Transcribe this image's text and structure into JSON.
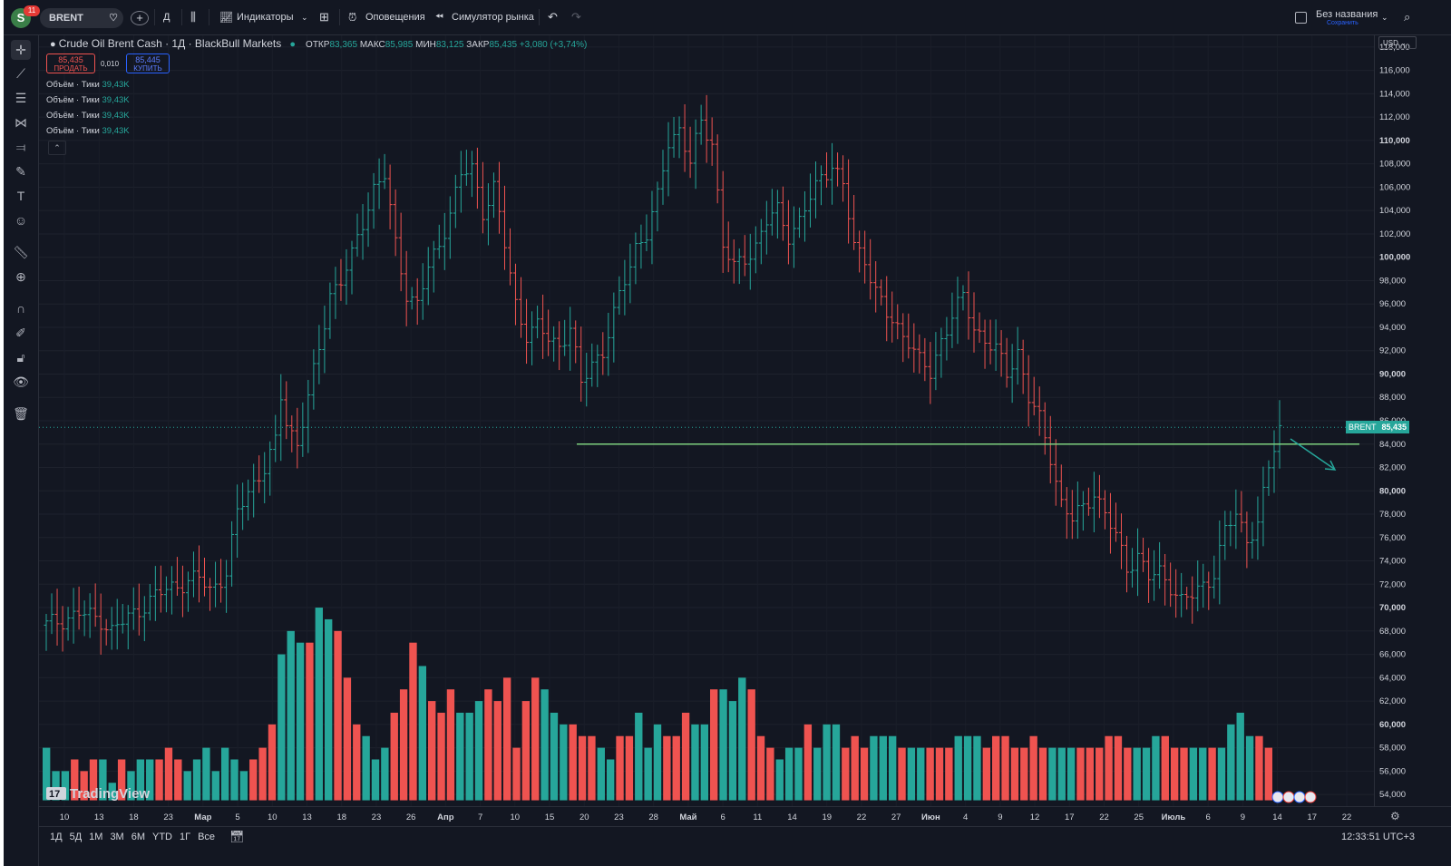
{
  "topbar": {
    "avatar_letter": "S",
    "avatar_badge": "11",
    "symbol": "BRENT",
    "interval": "Д",
    "indicators_label": "Индикаторы",
    "alerts_label": "Оповещения",
    "replay_label": "Симулятор рынка",
    "layout_name": "Без названия",
    "layout_save": "Сохранить"
  },
  "legend": {
    "title": "Crude Oil Brent Cash · 1Д · BlackBull Markets",
    "ohlc": [
      {
        "label": "ОТКР",
        "value": "83,365"
      },
      {
        "label": "МАКС",
        "value": "85,985"
      },
      {
        "label": "МИН",
        "value": "83,125"
      },
      {
        "label": "ЗАКР",
        "value": "85,435"
      }
    ],
    "change": "+3,080 (+3,74%)",
    "sell_price": "85,435",
    "sell_label": "ПРОДАТЬ",
    "spread": "0,010",
    "buy_price": "85,445",
    "buy_label": "КУПИТЬ",
    "indicators": [
      {
        "name": "Объём · Тики",
        "value": "39,43K"
      },
      {
        "name": "Объём · Тики",
        "value": "39,43K"
      },
      {
        "name": "Объём · Тики",
        "value": "39,43K"
      },
      {
        "name": "Объём · Тики",
        "value": "39,43K"
      }
    ]
  },
  "price_axis": {
    "currency": "USD",
    "labels": [
      "118,000",
      "116,000",
      "114,000",
      "112,000",
      "110,000",
      "108,000",
      "106,000",
      "104,000",
      "102,000",
      "100,000",
      "98,000",
      "96,000",
      "94,000",
      "92,000",
      "90,000",
      "88,000",
      "86,000",
      "84,000",
      "82,000",
      "80,000",
      "78,000",
      "76,000",
      "74,000",
      "72,000",
      "70,000",
      "68,000",
      "66,000",
      "64,000",
      "62,000",
      "60,000",
      "58,000",
      "56,000",
      "54,000"
    ],
    "last_symbol": "BRENT",
    "last_price": "85,435"
  },
  "time_axis": {
    "labels": [
      "10",
      "13",
      "18",
      "23",
      "Мар",
      "5",
      "10",
      "13",
      "18",
      "23",
      "26",
      "Апр",
      "7",
      "10",
      "15",
      "20",
      "23",
      "28",
      "Май",
      "6",
      "11",
      "14",
      "19",
      "22",
      "27",
      "Июн",
      "4",
      "9",
      "12",
      "17",
      "22",
      "25",
      "Июль",
      "6",
      "9",
      "14",
      "17",
      "22"
    ]
  },
  "bottombar": {
    "ranges": [
      "1Д",
      "5Д",
      "1М",
      "3М",
      "6М",
      "YTD",
      "1Г",
      "Все"
    ],
    "clock": "12:33:51 UTC+3"
  },
  "watermark": "TradingView",
  "colors": {
    "up": "#26a69a",
    "down": "#ef5350",
    "level_line": "#7ed07e",
    "background": "#131722"
  },
  "chart_data": {
    "type": "ohlc",
    "symbol": "Crude Oil Brent Cash",
    "interval": "1D",
    "ylim": [
      53,
      119
    ],
    "levels": [
      {
        "price": 84.0
      }
    ],
    "volume": [
      58,
      56,
      56,
      57,
      56,
      57,
      57,
      55,
      57,
      56,
      57,
      57,
      57,
      58,
      57,
      56,
      57,
      58,
      56,
      58,
      57,
      56,
      57,
      58,
      60,
      66,
      68,
      67,
      67,
      70,
      69,
      68,
      64,
      60,
      59,
      57,
      58,
      61,
      63,
      67,
      65,
      62,
      61,
      63,
      61,
      61,
      62,
      63,
      62,
      64,
      58,
      62,
      64,
      63,
      61,
      60,
      60,
      59,
      59,
      58,
      57,
      59,
      59,
      61,
      58,
      60,
      59,
      59,
      61,
      60,
      60,
      63,
      63,
      62,
      64,
      63,
      59,
      58,
      57,
      58,
      58,
      60,
      58,
      60,
      60,
      58,
      59,
      58,
      59,
      59,
      59,
      58,
      58,
      58,
      58,
      58,
      58,
      59,
      59,
      59,
      58,
      59,
      59,
      58,
      58,
      59,
      58,
      58,
      58,
      58,
      58,
      58,
      58,
      59,
      59,
      58,
      58,
      58,
      59,
      59,
      58,
      58,
      58,
      58,
      58,
      58,
      60,
      61,
      59,
      59,
      58
    ]
  }
}
